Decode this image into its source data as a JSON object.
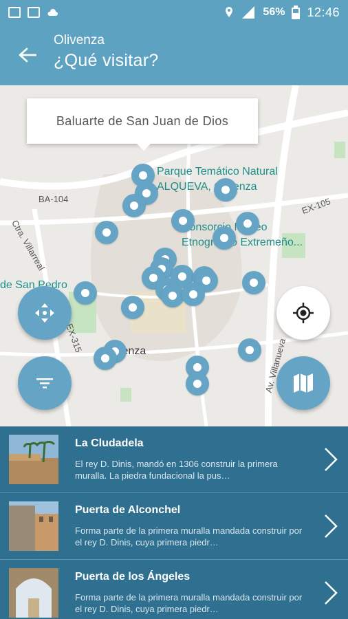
{
  "status_bar": {
    "battery": "56%",
    "time": "12:46",
    "network": "4G"
  },
  "app_bar": {
    "subtitle": "Olivenza",
    "title": "¿Qué visitar?"
  },
  "map": {
    "callout": "Baluarte de San Juan de Dios",
    "labels": {
      "park": "Parque Temático Natural",
      "park2": "ALQUEVA, Olivenza",
      "museum": "Consorcio Museo",
      "museum2": "Etnográfico Extremeño...",
      "san_pedro": "de San Pedro",
      "olivenza": "Olivenza",
      "ba104": "BA-104",
      "ex105": "EX-105",
      "ex315": "EX-315",
      "villarreal": "Ctra. Villarreal",
      "av": "Av. Villanueva"
    }
  },
  "items": [
    {
      "title": "La Cludadela",
      "description": "El rey D. Dinis, mandó en 1306 construir la primera muralla. La piedra fundacional la pus…"
    },
    {
      "title": "Puerta de Alconchel",
      "description": "Forma parte de la primera muralla mandada construir por el rey D. Dinis, cuya primera piedr…"
    },
    {
      "title": "Puerta de los Ángeles",
      "description": "Forma parte de la primera muralla mandada construir por el rey D. Dinis, cuya primera piedr…"
    }
  ]
}
